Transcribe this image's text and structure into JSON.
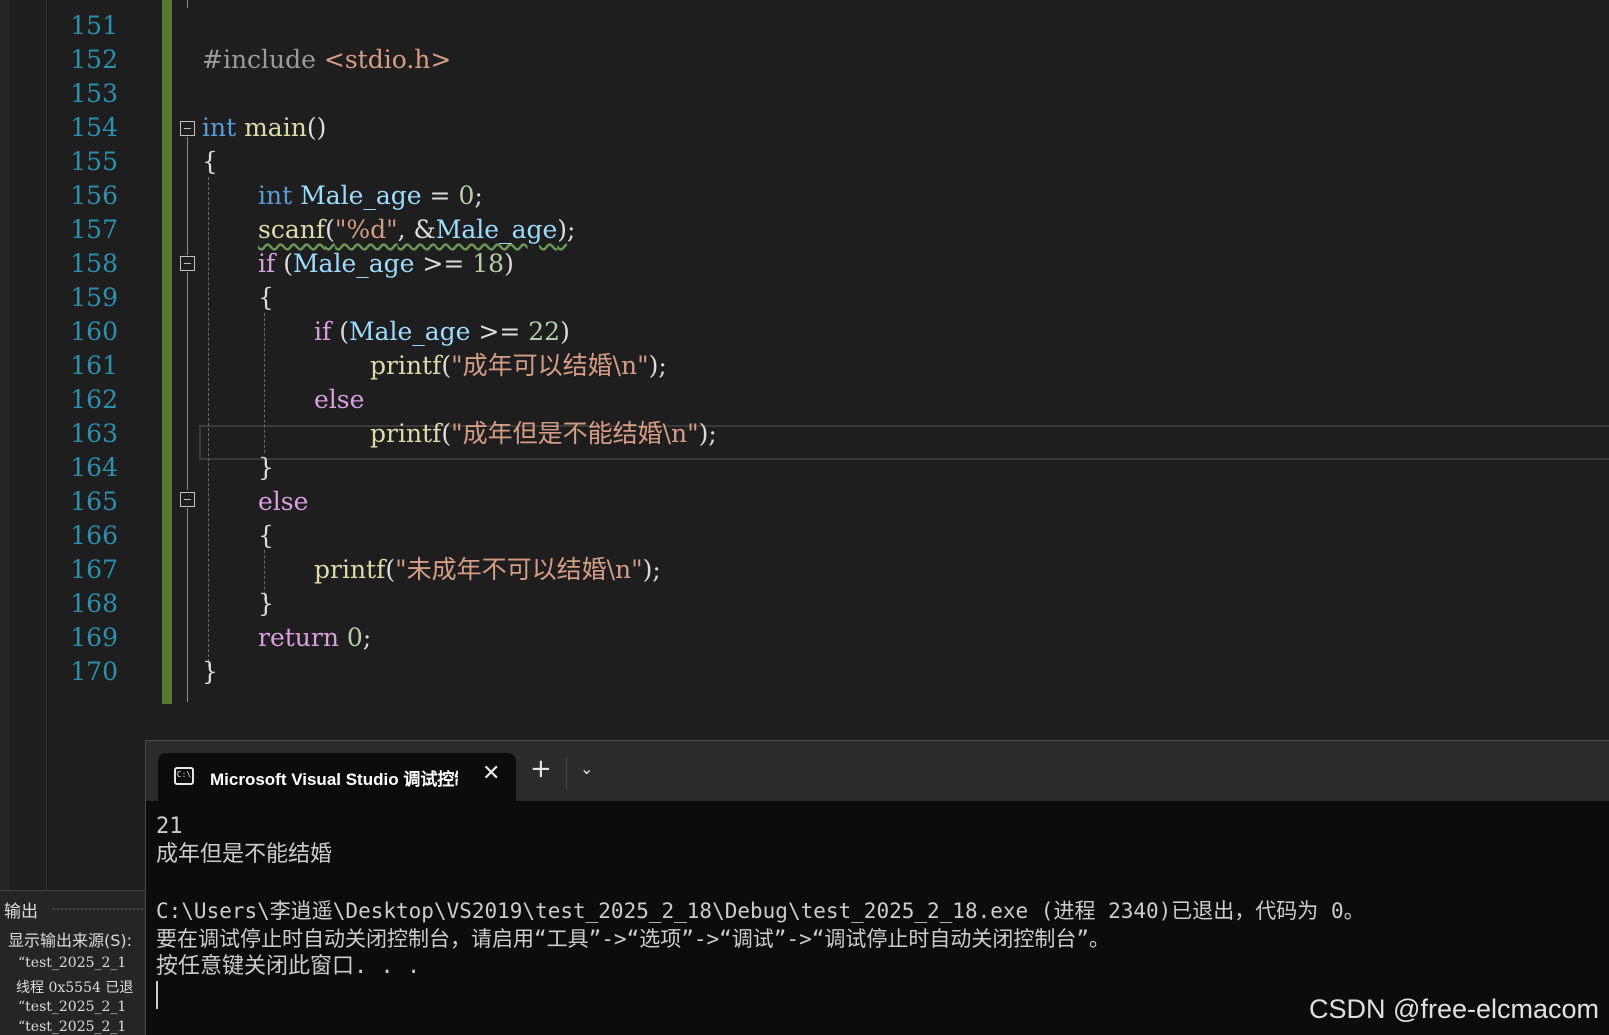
{
  "editor": {
    "lines": [
      {
        "num": "151"
      },
      {
        "num": "152"
      },
      {
        "num": "153"
      },
      {
        "num": "154"
      },
      {
        "num": "155"
      },
      {
        "num": "156"
      },
      {
        "num": "157"
      },
      {
        "num": "158"
      },
      {
        "num": "159"
      },
      {
        "num": "160"
      },
      {
        "num": "161"
      },
      {
        "num": "162"
      },
      {
        "num": "163"
      },
      {
        "num": "164"
      },
      {
        "num": "165"
      },
      {
        "num": "166"
      },
      {
        "num": "167"
      },
      {
        "num": "168"
      },
      {
        "num": "169"
      },
      {
        "num": "170"
      }
    ],
    "tokens": {
      "l152_a": "#include ",
      "l152_b": "<stdio.h>",
      "l154_a": "int",
      "l154_b": " main",
      "l154_c": "()",
      "l155": "{",
      "l156_a": "int",
      "l156_b": "Male_age",
      "l156_c": " = ",
      "l156_d": "0",
      "l156_e": ";",
      "l157_a": "scanf",
      "l157_b": "(",
      "l157_c": "\"%d\"",
      "l157_d": ", &",
      "l157_e": "Male_age",
      "l157_f": ")",
      "l157_g": ";",
      "l158_a": "if",
      "l158_b": " (",
      "l158_c": "Male_age",
      "l158_d": " >= ",
      "l158_e": "18",
      "l158_f": ")",
      "l159": "{",
      "l160_a": "if",
      "l160_b": " (",
      "l160_c": "Male_age",
      "l160_d": " >= ",
      "l160_e": "22",
      "l160_f": ")",
      "l161_a": "printf",
      "l161_b": "(",
      "l161_c": "\"成年可以结婚\\n\"",
      "l161_d": ");",
      "l162": "else",
      "l163_a": "printf",
      "l163_b": "(",
      "l163_c": "\"成年但是不能结婚\\n\"",
      "l163_d": ");",
      "l164": "}",
      "l165": "else",
      "l166": "{",
      "l167_a": "printf",
      "l167_b": "(",
      "l167_c": "\"未成年不可以结婚\\n\"",
      "l167_d": ");",
      "l168": "}",
      "l169_a": "return",
      "l169_b": " 0",
      "l169_c": ";",
      "l170": "}"
    }
  },
  "output_pane": {
    "title": "输出",
    "source_label": "显示输出来源(S):",
    "lines": [
      "“test_2025_2_1",
      "线程 0x5554 已退",
      "“test_2025_2_1",
      "“test_2025_2_1"
    ]
  },
  "console": {
    "tab_title": "Microsoft Visual Studio 调试控制台",
    "close_symbol": "✕",
    "new_tab_symbol": "+",
    "dropdown_symbol": "⌄",
    "icon_text": "C:\\",
    "lines": [
      "21",
      "成年但是不能结婚",
      "",
      "C:\\Users\\李逍遥\\Desktop\\VS2019\\test_2025_2_18\\Debug\\test_2025_2_18.exe (进程 2340)已退出，代码为 0。",
      "要在调试停止时自动关闭控制台，请启用“工具”->“选项”->“调试”->“调试停止时自动关闭控制台”。",
      "按任意键关闭此窗口. . ."
    ]
  },
  "watermark": "CSDN @free-elcmacom",
  "colors": {
    "keyword": "#569cd6",
    "control": "#d8a0df",
    "function": "#dcdcaa",
    "variable": "#9cdcfe",
    "number": "#b5cea8",
    "string": "#d69d85",
    "line_number": "#2b91af",
    "change_bar": "#577a32"
  }
}
